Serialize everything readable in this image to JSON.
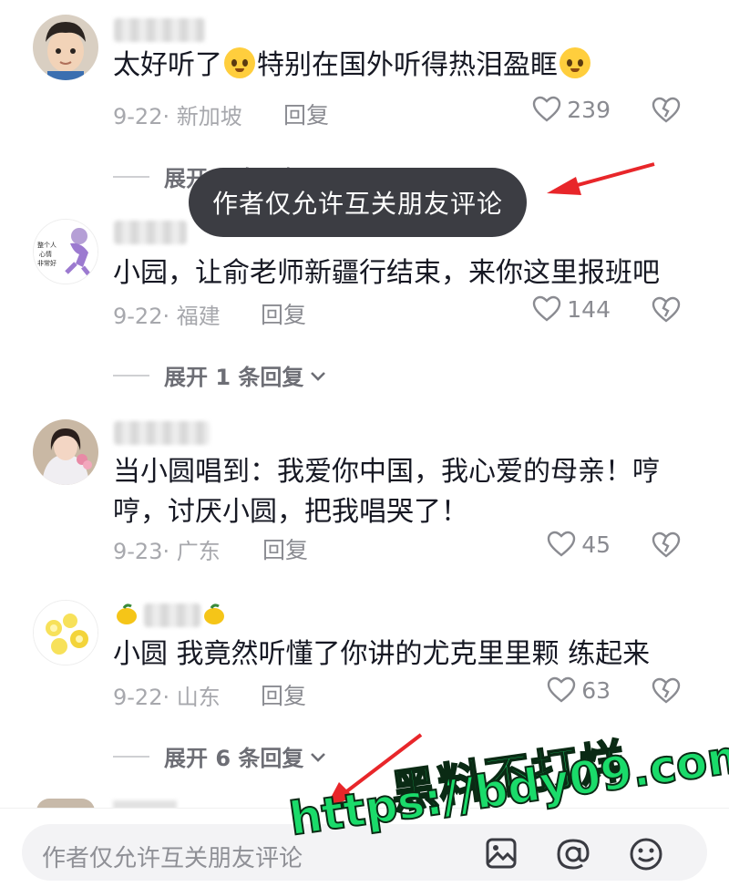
{
  "comments": [
    {
      "text_a": "太好听了",
      "text_b": "特别在国外听得热泪盈眶",
      "date_location": "9-22· 新加坡",
      "reply_label": "回复",
      "likes": "239",
      "expand_label": "展开 2 条回复"
    },
    {
      "text": "小园，让俞老师新疆行结束，来你这里报班吧",
      "date_location": "9-22· 福建",
      "reply_label": "回复",
      "likes": "144",
      "expand_label": "展开 1 条回复",
      "avatar_text": "整个人心情非常好"
    },
    {
      "text": "当小圆唱到：我爱你中国，我心爱的母亲！哼哼，讨厌小圆，把我唱哭了！",
      "date_location": "9-23· 广东",
      "reply_label": "回复",
      "likes": "45"
    },
    {
      "text": "小圆 我竟然听懂了你讲的尤克里里颗 练起来",
      "date_location": "9-22· 山东",
      "reply_label": "回复",
      "likes": "63",
      "expand_label": "展开 6 条回复"
    }
  ],
  "toast": "作者仅允许互关朋友评论",
  "input": {
    "placeholder": "作者仅允许互关朋友评论"
  },
  "watermark": {
    "line1": "黑料不打烊",
    "line2": "https://bdy09.com"
  },
  "icons": [
    "heart-icon",
    "dislike-heart-icon",
    "chevron-down-icon",
    "image-icon",
    "at-icon",
    "emoji-icon",
    "red-arrow"
  ],
  "colors": {
    "arrow": "#e8262a",
    "watermark": "#1adb6a",
    "toast_bg": "#3c3d43"
  }
}
